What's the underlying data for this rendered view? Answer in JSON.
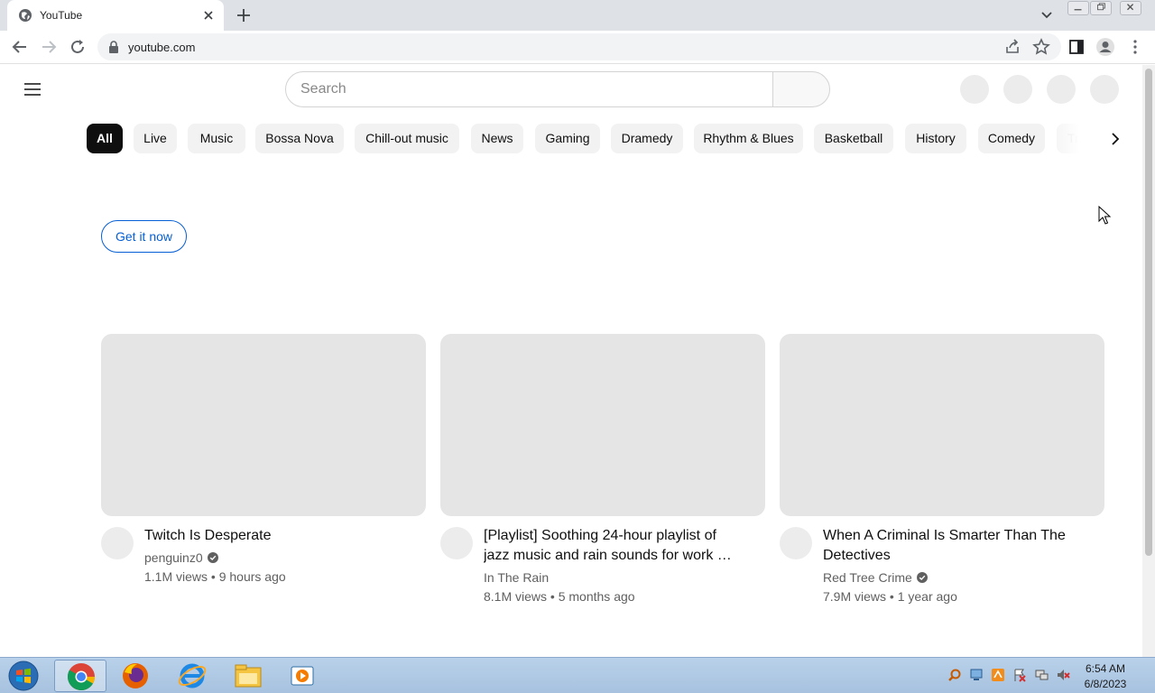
{
  "browser": {
    "tab_title": "YouTube",
    "url": "youtube.com"
  },
  "youtube": {
    "search_placeholder": "Search",
    "chips": [
      "All",
      "Live",
      "Music",
      "Bossa Nova",
      "Chill-out music",
      "News",
      "Gaming",
      "Dramedy",
      "Rhythm & Blues",
      "Basketball",
      "History",
      "Comedy",
      "Tr"
    ],
    "active_chip": "All",
    "promo_button": "Get it now",
    "videos": [
      {
        "title": "Twitch Is Desperate",
        "channel": "penguinz0",
        "verified": true,
        "views": "1.1M views",
        "age": "9 hours ago"
      },
      {
        "title": "[Playlist] Soothing 24-hour playlist of jazz music and rain sounds for work …",
        "channel": "In The Rain",
        "verified": false,
        "views": "8.1M views",
        "age": "5 months ago"
      },
      {
        "title": "When A Criminal Is Smarter Than The Detectives",
        "channel": "Red Tree Crime",
        "verified": true,
        "views": "7.9M views",
        "age": "1 year ago"
      }
    ]
  },
  "taskbar": {
    "time": "6:54 AM",
    "date": "6/8/2023"
  },
  "colors": {
    "accent_blue": "#065fd4",
    "chip_active": "#0f0f0f",
    "taskbar": "#b9d1ea"
  }
}
